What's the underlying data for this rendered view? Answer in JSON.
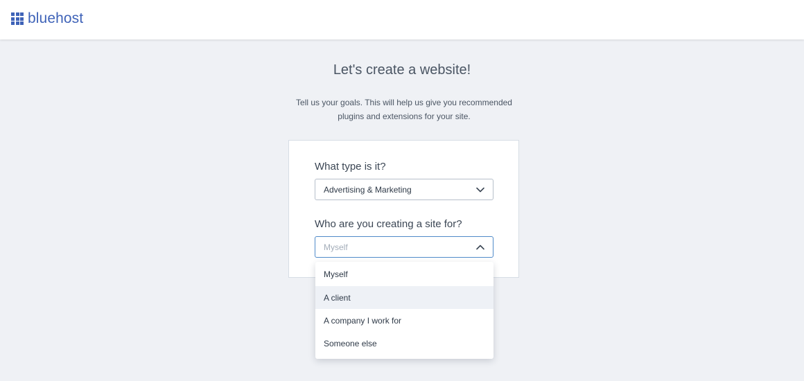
{
  "header": {
    "logo_text": "bluehost",
    "logo_icon": "grid-logo-icon",
    "brand_color": "#3f63b8"
  },
  "page": {
    "title": "Let's create a website!",
    "subtitle": "Tell us your goals. This will help us give you recommended plugins and extensions for your site."
  },
  "form": {
    "type_label": "What type is it?",
    "type_value": "Advertising & Marketing",
    "for_label": "Who are you creating a site for?",
    "for_placeholder": "Myself",
    "for_options": [
      "Myself",
      "A client",
      "A company I work for",
      "Someone else"
    ],
    "hovered_option": "A client"
  },
  "colors": {
    "background": "#eff1f5",
    "focus_border": "#4f8ac9"
  }
}
